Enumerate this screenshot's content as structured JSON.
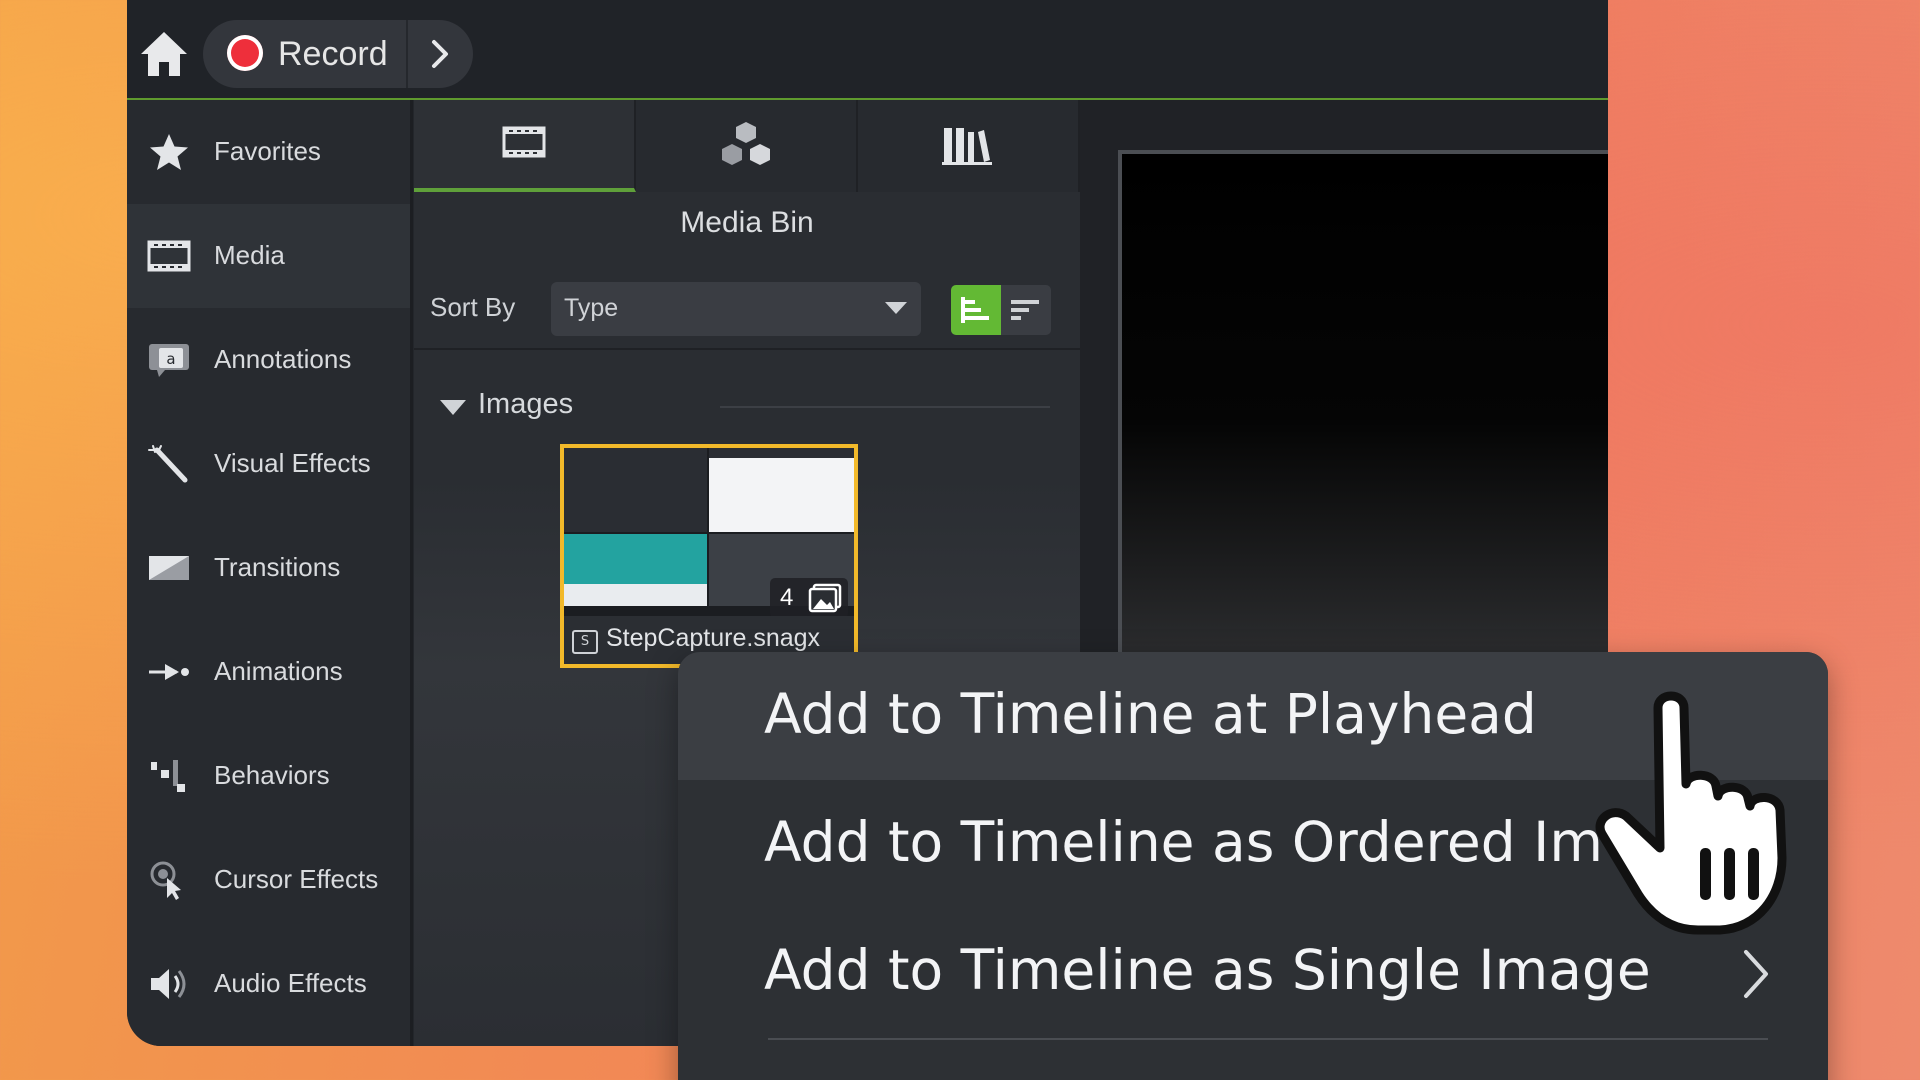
{
  "topbar": {
    "record_label": "Record"
  },
  "sidebar": {
    "items": [
      {
        "label": "Favorites",
        "icon": "star-icon"
      },
      {
        "label": "Media",
        "icon": "filmstrip-icon"
      },
      {
        "label": "Annotations",
        "icon": "annotation-icon"
      },
      {
        "label": "Visual Effects",
        "icon": "magic-wand-icon"
      },
      {
        "label": "Transitions",
        "icon": "transition-icon"
      },
      {
        "label": "Animations",
        "icon": "animation-arrow-icon"
      },
      {
        "label": "Behaviors",
        "icon": "behaviors-icon"
      },
      {
        "label": "Cursor Effects",
        "icon": "cursor-effects-icon"
      },
      {
        "label": "Audio Effects",
        "icon": "speaker-icon"
      }
    ],
    "active": "Media"
  },
  "media_panel": {
    "tabs": [
      "media-bin-tab",
      "library-cubes-tab",
      "library-books-tab"
    ],
    "title": "Media Bin",
    "sort_label": "Sort By",
    "sort_value": "Type",
    "group_label": "Images",
    "items": [
      {
        "name": "StepCapture.snagx",
        "count": "4"
      }
    ]
  },
  "context_menu": {
    "items": [
      "Add to Timeline at Playhead",
      "Add to Timeline as Ordered Im",
      "Add to Timeline as Single Image"
    ]
  },
  "colors": {
    "accent_green": "#63b934",
    "selection_yellow": "#f2b92a",
    "record_red": "#ee2f3b"
  }
}
